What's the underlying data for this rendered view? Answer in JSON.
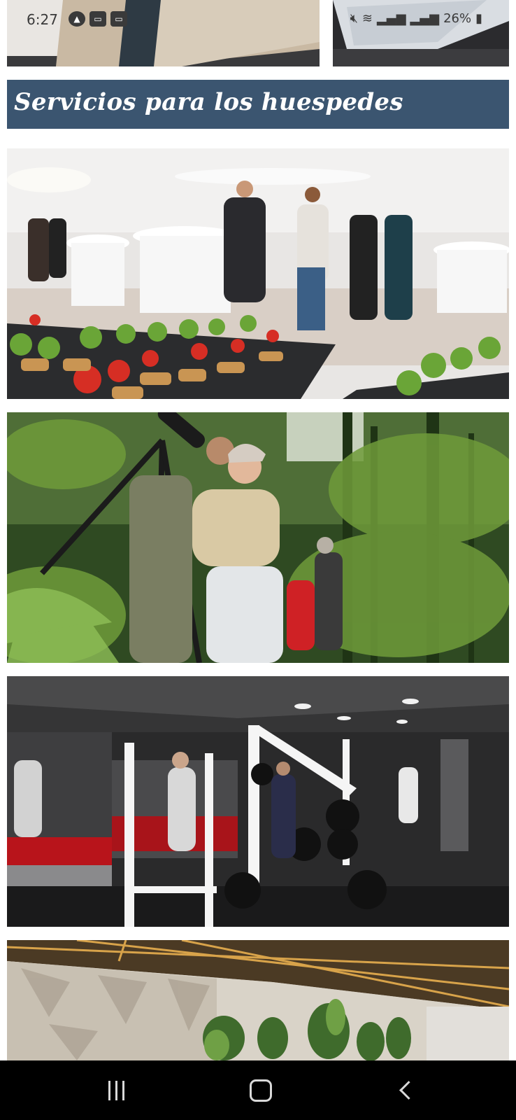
{
  "status_bar": {
    "time": "6:27",
    "left_icons": [
      "navigation-icon",
      "sim-card-icon",
      "sim-card-icon"
    ],
    "right_icons": [
      "mute-icon",
      "wifi-icon",
      "signal-icon",
      "signal-icon",
      "battery-icon"
    ],
    "battery_text": "26%"
  },
  "section": {
    "title": "Servicios para los huespedes",
    "header_color": "#3b5570"
  },
  "images": [
    {
      "name": "bed-photo-left",
      "subject": "bed"
    },
    {
      "name": "bed-photo-right",
      "subject": "bed"
    },
    {
      "name": "catering-photo",
      "subject": "catering event"
    },
    {
      "name": "birdwatching-photo",
      "subject": "birdwatching in forest"
    },
    {
      "name": "gym-photo",
      "subject": "gym"
    },
    {
      "name": "lobby-photo",
      "subject": "lobby with plants"
    }
  ],
  "nav_bar": {
    "buttons": [
      "recents-icon",
      "home-icon",
      "back-icon"
    ]
  }
}
